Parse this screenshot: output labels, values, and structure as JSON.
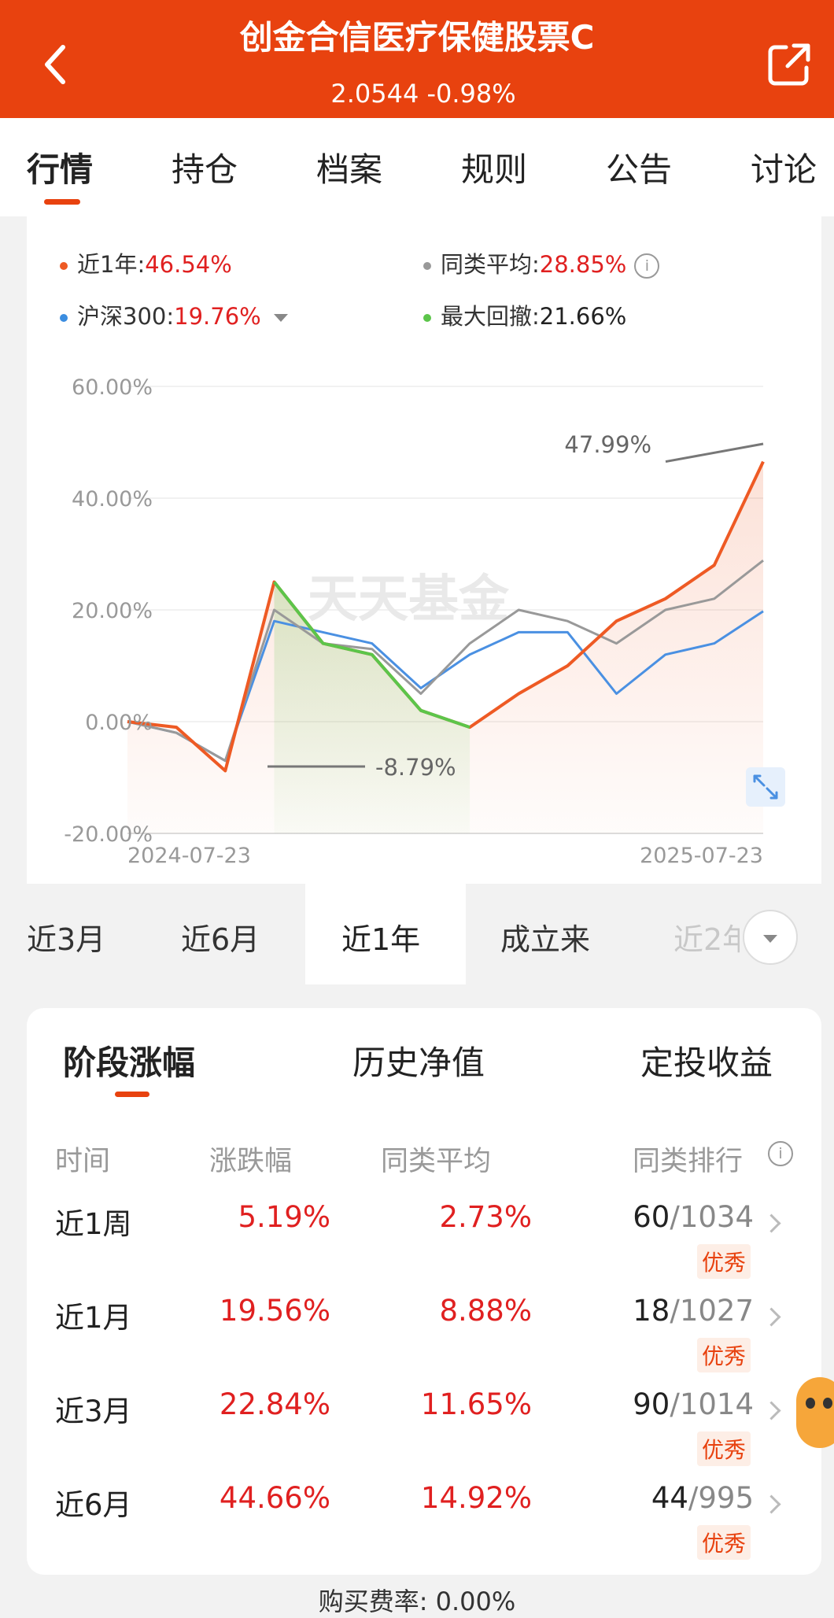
{
  "header": {
    "title": "创金合信医疗保健股票C",
    "subtitle": "2.0544 -0.98%",
    "bg_color": "#e8420f",
    "back_icon": "back-arrow-icon",
    "share_icon": "share-icon"
  },
  "tabs": [
    "行情",
    "持仓",
    "档案",
    "规则",
    "公告",
    "讨论"
  ],
  "legend": {
    "fund_label": "近1年:",
    "fund_value": "46.54%",
    "peer_label": "同类平均:",
    "peer_value": "28.85%",
    "index_label": "沪深300:",
    "index_value": "19.76%",
    "drawdown_label": "最大回撤:",
    "drawdown_value": "21.66%"
  },
  "chart_data": {
    "type": "line",
    "x": [
      "2024-07-23",
      "2024-08-23",
      "2024-09-23",
      "2024-10-23",
      "2024-11-23",
      "2024-12-23",
      "2025-01-23",
      "2025-02-23",
      "2025-03-23",
      "2025-04-23",
      "2025-05-23",
      "2025-06-23",
      "2025-07-23"
    ],
    "xticks": [
      "2024-07-23",
      "2025-07-23"
    ],
    "yticks": [
      "60.00%",
      "40.00%",
      "20.00%",
      "0.00%",
      "-20.00%"
    ],
    "ylim": [
      -20,
      60
    ],
    "series": [
      {
        "name": "近1年",
        "color": "#ee5a24",
        "values": [
          0,
          -1,
          -8.79,
          25,
          14,
          12,
          2,
          -1,
          5,
          10,
          18,
          22,
          28,
          46.54
        ]
      },
      {
        "name": "同类平均",
        "color": "#999999",
        "values": [
          0,
          -2,
          -7,
          20,
          14,
          13,
          5,
          14,
          20,
          18,
          14,
          20,
          22,
          28.85
        ]
      },
      {
        "name": "沪深300",
        "color": "#4a90e2",
        "values": [
          0,
          -2,
          -7,
          18,
          16,
          14,
          6,
          12,
          16,
          16,
          5,
          12,
          14,
          19.76
        ]
      }
    ],
    "annotations": [
      "47.99%",
      "-8.79%"
    ],
    "watermark": "天天基金"
  },
  "periods": [
    "近3月",
    "近6月",
    "近1年",
    "成立来",
    "近2年"
  ],
  "perf_tabs": [
    "阶段涨幅",
    "历史净值",
    "定投收益"
  ],
  "table": {
    "headers": [
      "时间",
      "涨跌幅",
      "同类平均",
      "同类排行"
    ],
    "rows": [
      {
        "period": "近1周",
        "change": "5.19%",
        "avg": "2.73%",
        "rank": "60",
        "total": "/1034",
        "badge": "优秀"
      },
      {
        "period": "近1月",
        "change": "19.56%",
        "avg": "8.88%",
        "rank": "18",
        "total": "/1027",
        "badge": "优秀"
      },
      {
        "period": "近3月",
        "change": "22.84%",
        "avg": "11.65%",
        "rank": "90",
        "total": "/1014",
        "badge": "优秀"
      },
      {
        "period": "近6月",
        "change": "44.66%",
        "avg": "14.92%",
        "rank": "44",
        "total": "/995",
        "badge": "优秀"
      }
    ]
  },
  "footer": "购买费率: 0.00%"
}
